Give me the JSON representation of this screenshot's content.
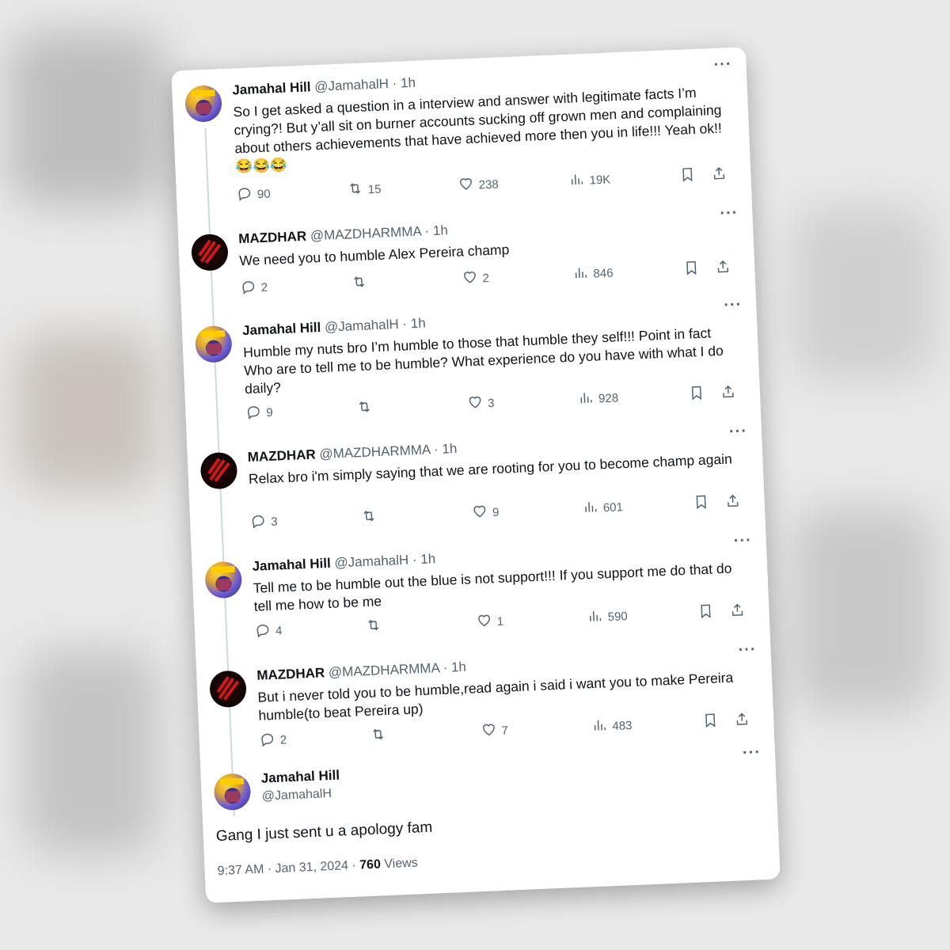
{
  "tweets": [
    {
      "name": "Jamahal Hill",
      "handle": "@JamahalH",
      "sep": "·",
      "time": "1h",
      "avatar": "jamahal-avatar",
      "text": "So I get asked a question in a interview and answer with legitimate facts I’m crying?! But y’all sit on burner accounts sucking off grown men and complaining about others achievements that have achieved more then you in life!!! Yeah ok!! 😂😂😂",
      "replies": "90",
      "retweets": "15",
      "likes": "238",
      "views": "19K"
    },
    {
      "name": "MAZDHAR",
      "handle": "@MAZDHARMMA",
      "sep": "·",
      "time": "1h",
      "avatar": "mazdhar-avatar",
      "text": "We need you to humble Alex Pereira champ",
      "replies": "2",
      "retweets": "",
      "likes": "2",
      "views": "846"
    },
    {
      "name": "Jamahal Hill",
      "handle": "@JamahalH",
      "sep": "·",
      "time": "1h",
      "avatar": "jamahal-avatar",
      "text": "Humble my nuts bro I’m humble to those that humble they self!!! Point in fact Who are to tell me to be humble? What experience do you have with what I do daily?",
      "replies": "9",
      "retweets": "",
      "likes": "3",
      "views": "928"
    },
    {
      "name": "MAZDHAR",
      "handle": "@MAZDHARMMA",
      "sep": "·",
      "time": "1h",
      "avatar": "mazdhar-avatar",
      "text": "Relax bro i'm simply saying that we are rooting for you to become champ again",
      "replies": "3",
      "retweets": "",
      "likes": "9",
      "views": "601"
    },
    {
      "name": "Jamahal Hill",
      "handle": "@JamahalH",
      "sep": "·",
      "time": "1h",
      "avatar": "jamahal-avatar",
      "text": "Tell me to be humble out the blue is not support!!! If you support me do that do tell me how to be me",
      "replies": "4",
      "retweets": "",
      "likes": "1",
      "views": "590"
    },
    {
      "name": "MAZDHAR",
      "handle": "@MAZDHARMMA",
      "sep": "·",
      "time": "1h",
      "avatar": "mazdhar-avatar",
      "text": "But i never told you to be humble,read again i said i want you to make Pereira humble(to beat Pereira up)",
      "replies": "2",
      "retweets": "",
      "likes": "7",
      "views": "483"
    }
  ],
  "final": {
    "name": "Jamahal Hill",
    "handle": "@JamahalH",
    "text": "Gang I just sent u a apology fam",
    "time": "9:37 AM",
    "date_sep": "·",
    "date": "Jan 31, 2024",
    "meta_sep": "·",
    "views": "760",
    "views_label": "Views"
  },
  "more_icon": "···",
  "icons": [
    "reply-icon",
    "retweet-icon",
    "like-icon",
    "views-icon",
    "bookmark-icon",
    "share-icon"
  ],
  "colors": {
    "text": "#0f1419",
    "secondary": "#536471",
    "thread_line": "#cfd9de"
  }
}
